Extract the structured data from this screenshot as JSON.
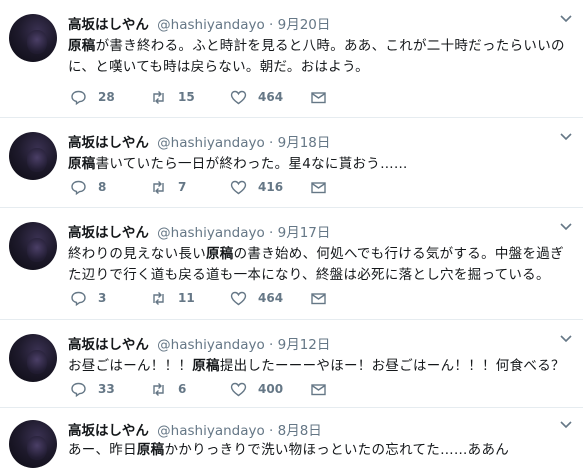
{
  "tweets": [
    {
      "author": {
        "name": "高坂はしやん",
        "handle": "@hashiyandayo"
      },
      "date": "9月20日",
      "text_pre": "",
      "highlight": "原稿",
      "text_post": "が書き終わる。ふと時計を見ると八時。ああ、これが二十時だったらいいのに、と嘆いても時は戻らない。朝だ。おはよう。",
      "replies": "28",
      "retweets": "15",
      "likes": "464"
    },
    {
      "author": {
        "name": "高坂はしやん",
        "handle": "@hashiyandayo"
      },
      "date": "9月18日",
      "text_pre": "",
      "highlight": "原稿",
      "text_post": "書いていたら一日が終わった。星4なに貰おう……",
      "replies": "8",
      "retweets": "7",
      "likes": "416"
    },
    {
      "author": {
        "name": "高坂はしやん",
        "handle": "@hashiyandayo"
      },
      "date": "9月17日",
      "text_pre": "終わりの見えない長い",
      "highlight": "原稿",
      "text_post": "の書き始め、何処へでも行ける気がする。中盤を過ぎた辺りで行く道も戻る道も一本になり、終盤は必死に落とし穴を掘っている。",
      "replies": "3",
      "retweets": "11",
      "likes": "464"
    },
    {
      "author": {
        "name": "高坂はしやん",
        "handle": "@hashiyandayo"
      },
      "date": "9月12日",
      "text_pre": "お昼ごはーん！！！",
      "highlight": "原稿",
      "text_post": "提出したーーーやほー！お昼ごはーん！！！何食べる？",
      "replies": "33",
      "retweets": "6",
      "likes": "400"
    },
    {
      "author": {
        "name": "高坂はしやん",
        "handle": "@hashiyandayo"
      },
      "date": "8月8日",
      "text_pre": "あー、昨日",
      "highlight": "原稿",
      "text_post": "かかりっきりで洗い物ほっといたの忘れてた……ああん",
      "replies": "",
      "retweets": "",
      "likes": ""
    }
  ],
  "colors": {
    "text": "#14171a",
    "muted": "#657786",
    "border": "#e6ecf0"
  },
  "icons": [
    "reply-icon",
    "retweet-icon",
    "like-icon",
    "dm-icon",
    "chevron-down-icon"
  ]
}
